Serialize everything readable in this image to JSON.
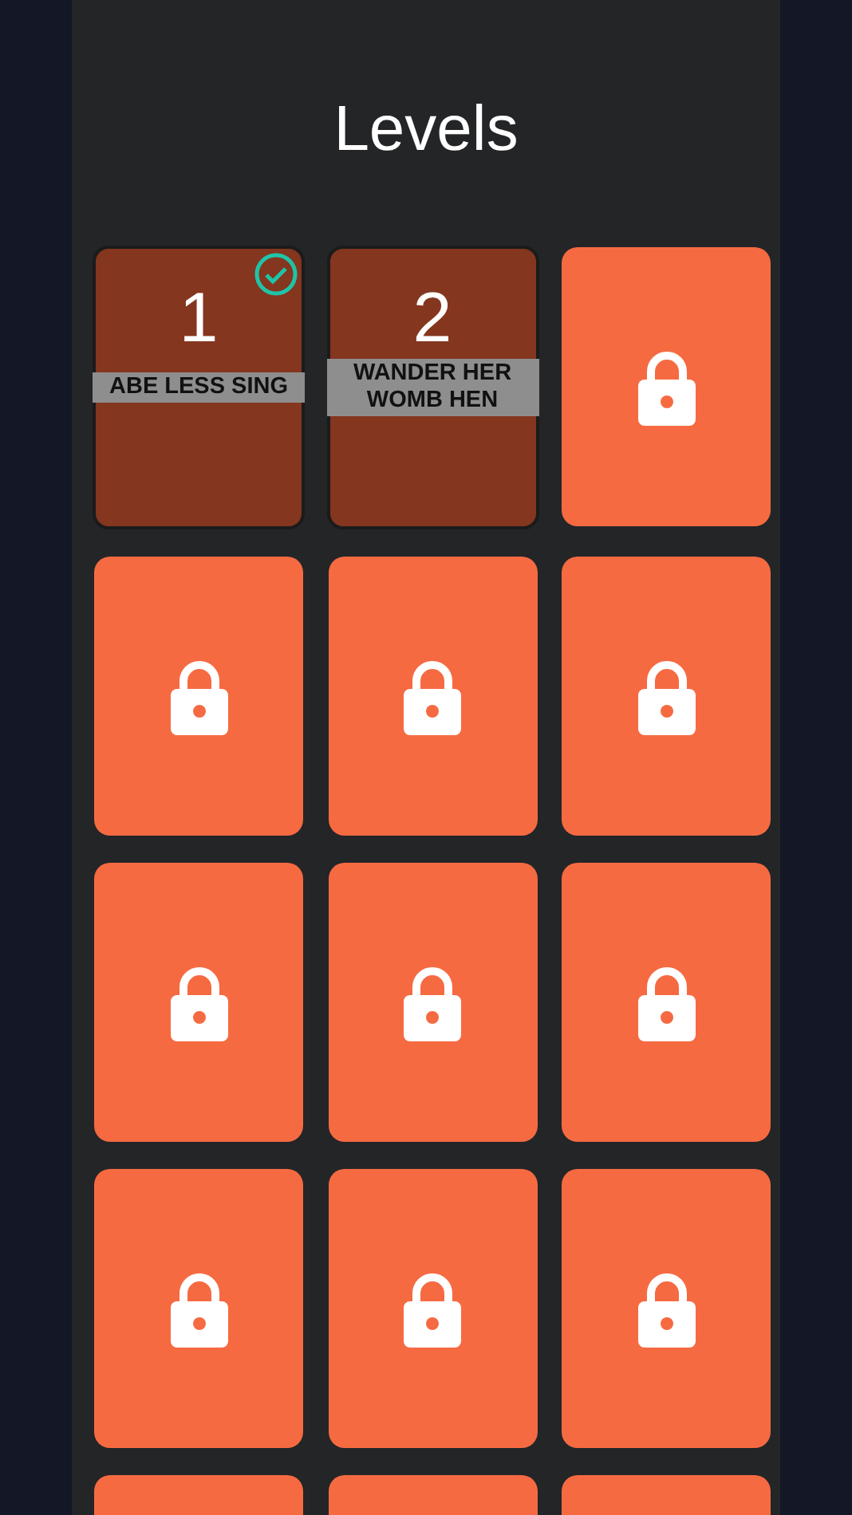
{
  "title": "Levels",
  "levels": [
    {
      "kind": "unlocked",
      "number": "1",
      "phrase": "ABE LESS SING",
      "completed": true
    },
    {
      "kind": "unlocked",
      "number": "2",
      "phrase": "WANDER HER WOMB HEN",
      "completed": false
    },
    {
      "kind": "locked"
    },
    {
      "kind": "locked"
    },
    {
      "kind": "locked"
    },
    {
      "kind": "locked"
    },
    {
      "kind": "locked"
    },
    {
      "kind": "locked"
    },
    {
      "kind": "locked"
    },
    {
      "kind": "locked"
    },
    {
      "kind": "locked"
    },
    {
      "kind": "locked"
    },
    {
      "kind": "cut"
    },
    {
      "kind": "cut"
    },
    {
      "kind": "cut"
    }
  ]
}
